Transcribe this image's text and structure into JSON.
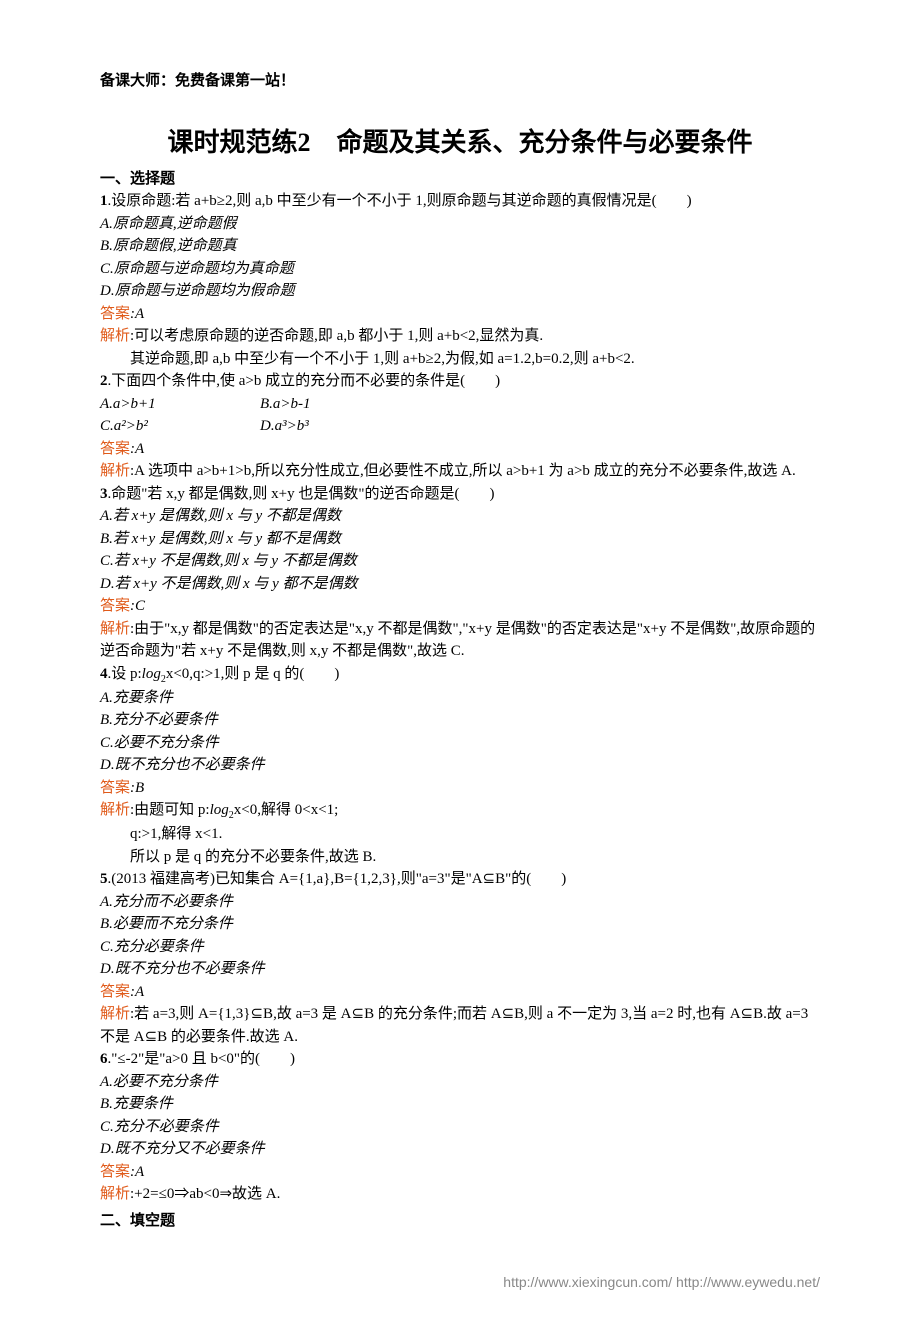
{
  "header": "备课大师：免费备课第一站！",
  "title": "课时规范练2　命题及其关系、充分条件与必要条件",
  "sec1": "一、选择题",
  "q1": {
    "num": "1",
    "stem": ".设原命题:若 a+b≥2,则 a,b 中至少有一个不小于 1,则原命题与其逆命题的真假情况是(　　)",
    "A": "A.原命题真,逆命题假",
    "B": "B.原命题假,逆命题真",
    "C": "C.原命题与逆命题均为真命题",
    "D": "D.原命题与逆命题均为假命题",
    "ansLabel": "答案",
    "ans": ":A",
    "expLabel": "解析",
    "exp1": ":可以考虑原命题的逆否命题,即 a,b 都小于 1,则 a+b<2,显然为真.",
    "exp2": "　　其逆命题,即 a,b 中至少有一个不小于 1,则 a+b≥2,为假,如 a=1.2,b=0.2,则 a+b<2."
  },
  "q2": {
    "num": "2",
    "stem": ".下面四个条件中,使 a>b 成立的充分而不必要的条件是(　　)",
    "A": "A.a>b+1",
    "B": "B.a>b-1",
    "C": "C.a²>b²",
    "D": "D.a³>b³",
    "ansLabel": "答案",
    "ans": ":A",
    "expLabel": "解析",
    "exp": ":A 选项中 a>b+1>b,所以充分性成立,但必要性不成立,所以 a>b+1 为 a>b 成立的充分不必要条件,故选 A."
  },
  "q3": {
    "num": "3",
    "stem": ".命题\"若 x,y 都是偶数,则 x+y 也是偶数\"的逆否命题是(　　)",
    "A": "A.若 x+y 是偶数,则 x 与 y 不都是偶数",
    "B": "B.若 x+y 是偶数,则 x 与 y 都不是偶数",
    "C": "C.若 x+y 不是偶数,则 x 与 y 不都是偶数",
    "D": "D.若 x+y 不是偶数,则 x 与 y 都不是偶数",
    "ansLabel": "答案",
    "ans": ":C",
    "expLabel": "解析",
    "exp": ":由于\"x,y 都是偶数\"的否定表达是\"x,y 不都是偶数\",\"x+y 是偶数\"的否定表达是\"x+y 不是偶数\",故原命题的逆否命题为\"若 x+y 不是偶数,则 x,y 不都是偶数\",故选 C."
  },
  "q4": {
    "num": "4",
    "stem_a": ".设 p:",
    "stem_b": "x<0,q:>1,则 p 是 q 的(　　)",
    "A": "A.充要条件",
    "B": "B.充分不必要条件",
    "C": "C.必要不充分条件",
    "D": "D.既不充分也不必要条件",
    "ansLabel": "答案",
    "ans": ":B",
    "expLabel": "解析",
    "exp1_a": ":由题可知 p:",
    "exp1_b": "x<0,解得 0<x<1;",
    "exp2": "　　q:>1,解得 x<1.",
    "exp3": "　　所以 p 是 q 的充分不必要条件,故选 B."
  },
  "q5": {
    "num": "5",
    "stem": ".(2013 福建高考)已知集合 A={1,a},B={1,2,3},则\"a=3\"是\"A⊆B\"的(　　)",
    "A": "A.充分而不必要条件",
    "B": "B.必要而不充分条件",
    "C": "C.充分必要条件",
    "D": "D.既不充分也不必要条件",
    "ansLabel": "答案",
    "ans": ":A",
    "expLabel": "解析",
    "exp": ":若 a=3,则 A={1,3}⊆B,故 a=3 是 A⊆B 的充分条件;而若 A⊆B,则 a 不一定为 3,当 a=2 时,也有 A⊆B.故 a=3 不是 A⊆B 的必要条件.故选 A."
  },
  "q6": {
    "num": "6",
    "stem": ".\"≤-2\"是\"a>0 且 b<0\"的(　　)",
    "A": "A.必要不充分条件",
    "B": "B.充要条件",
    "C": "C.充分不必要条件",
    "D": "D.既不充分又不必要条件",
    "ansLabel": "答案",
    "ans": ":A",
    "expLabel": "解析",
    "exp": ":+2=≤0⇒ab<0⇒故选 A."
  },
  "sec2": "二、填空题",
  "footer": "http://www.xiexingcun.com/ http://www.eywedu.net/"
}
